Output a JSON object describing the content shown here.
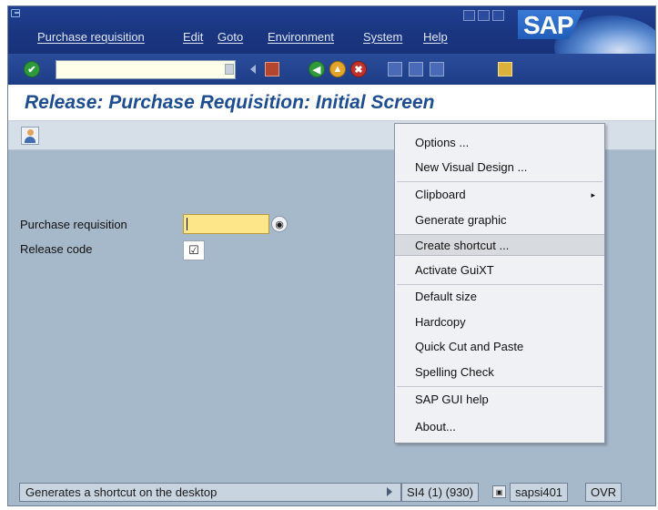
{
  "window": {
    "menu": [
      {
        "label": "Purchase requisition"
      },
      {
        "label": "Edit"
      },
      {
        "label": "Goto"
      },
      {
        "label": "Environment"
      },
      {
        "label": "System"
      },
      {
        "label": "Help"
      }
    ],
    "logo_text": "SAP"
  },
  "toolbar": {
    "command_field_value": "",
    "icons": [
      "enter-icon",
      "command-dropdown-icon",
      "back-arrow-icon",
      "save-icon",
      "back-icon",
      "exit-icon",
      "cancel-icon",
      "print-icon",
      "find-icon",
      "find-next-icon",
      "create-session-icon"
    ]
  },
  "screen": {
    "title": "Release: Purchase Requisition: Initial Screen"
  },
  "form": {
    "purchase_requisition_label": "Purchase requisition",
    "purchase_requisition_value": "",
    "release_code_label": "Release code",
    "release_code_checked": true
  },
  "context_menu": {
    "items": [
      {
        "label": "Options ..."
      },
      {
        "label": "New Visual Design ..."
      },
      {
        "label": "Clipboard",
        "submenu": true
      },
      {
        "label": "Generate graphic"
      },
      {
        "label": "Create shortcut ...",
        "highlighted": true
      },
      {
        "label": "Activate GuiXT"
      },
      {
        "label": "Default size"
      },
      {
        "label": "Hardcopy"
      },
      {
        "label": "Quick Cut and Paste"
      },
      {
        "label": "Spelling Check"
      },
      {
        "label": "SAP GUI help"
      },
      {
        "label": "About..."
      }
    ]
  },
  "status_bar": {
    "message": "Generates a shortcut on the desktop",
    "system": "SI4 (1) (930)",
    "server": "sapsi401",
    "mode": "OVR"
  },
  "colors": {
    "menubar": "#1f3f92",
    "background": "#a6b9cb",
    "title_text": "#1e4e8f",
    "required_field": "#fde68a"
  }
}
